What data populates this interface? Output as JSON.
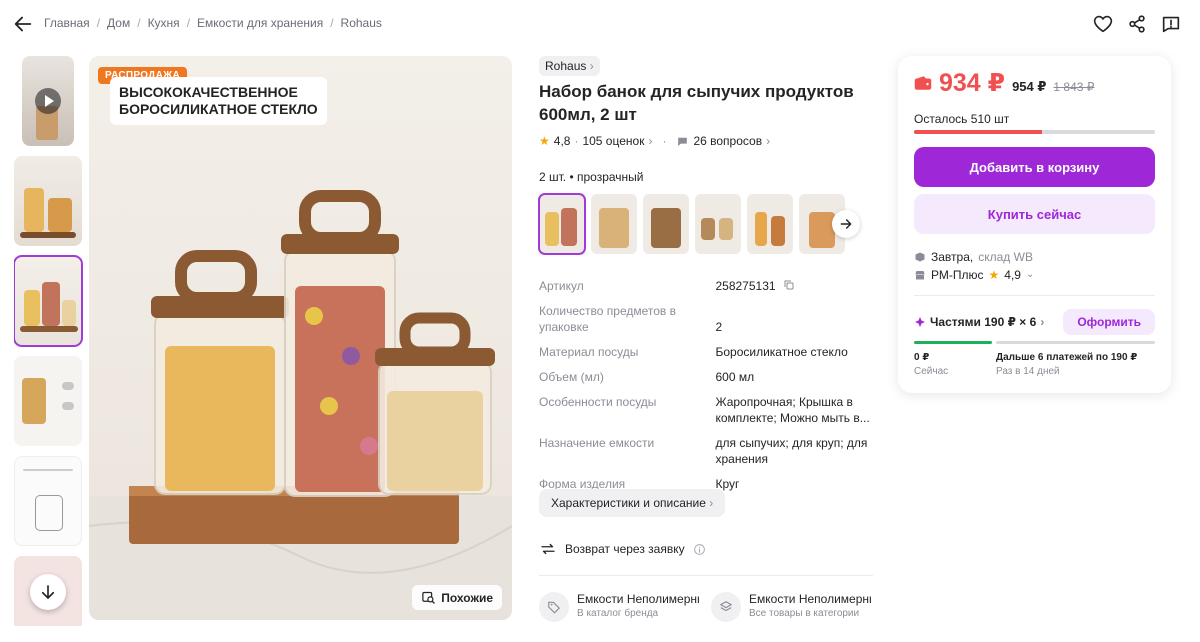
{
  "breadcrumbs": [
    "Главная",
    "Дом",
    "Кухня",
    "Емкости для хранения",
    "Rohaus"
  ],
  "gallery": {
    "sale_badge": "РАСПРОДАЖА",
    "headline_line1": "ВЫСОКОКАЧЕСТВЕННОЕ",
    "headline_line2": "БОРОСИЛИКАТНОЕ СТЕКЛО",
    "similar_label": "Похожие"
  },
  "product": {
    "brand": "Rohaus",
    "title": "Набор банок для сыпучих продуктов 600мл, 2 шт",
    "rating": "4,8",
    "reviews": "105 оценок",
    "questions": "26 вопросов",
    "variant_label": "2 шт. • прозрачный"
  },
  "specs": [
    {
      "k": "Артикул",
      "v": "258275131"
    },
    {
      "k": "Количество предметов в упаковке",
      "v": "2"
    },
    {
      "k": "Материал посуды",
      "v": "Боросиликатное стекло"
    },
    {
      "k": "Объем (мл)",
      "v": "600 мл"
    },
    {
      "k": "Особенности посуды",
      "v": "Жаропрочная; Крышка в комплекте; Можно мыть в..."
    },
    {
      "k": "Назначение емкости",
      "v": "для сыпучих; для круп; для хранения"
    },
    {
      "k": "Форма изделия",
      "v": "Круг"
    }
  ],
  "characteristics_button": "Характеристики и описание",
  "return_text": "Возврат через заявку",
  "category_links": [
    {
      "title": "Емкости Неполимерные",
      "subtitle": "В каталог бренда"
    },
    {
      "title": "Емкости Неполимерные",
      "subtitle": "Все товары в категории"
    }
  ],
  "buy": {
    "price": "934 ₽",
    "price_alt": "954 ₽",
    "price_old": "1 843 ₽",
    "stock": "Осталось 510 шт",
    "stock_fraction": 0.53,
    "add_to_cart": "Добавить в корзину",
    "buy_now": "Купить сейчас",
    "delivery_date": "Завтра,",
    "delivery_warehouse": "склад WB",
    "seller": "РМ-Плюс",
    "seller_rating": "4,9",
    "installments": "Частями 190 ₽ × 6",
    "order_button": "Оформить",
    "now_amount": "0 ₽",
    "now_label": "Сейчас",
    "later_amount": "Дальше 6 платежей по 190 ₽",
    "later_label": "Раз в 14 дней"
  },
  "colors": {
    "accent": "#9e27d8",
    "price_red": "#f0504f",
    "sale_orange": "#f0761f",
    "installment_green": "#1fb05a"
  }
}
